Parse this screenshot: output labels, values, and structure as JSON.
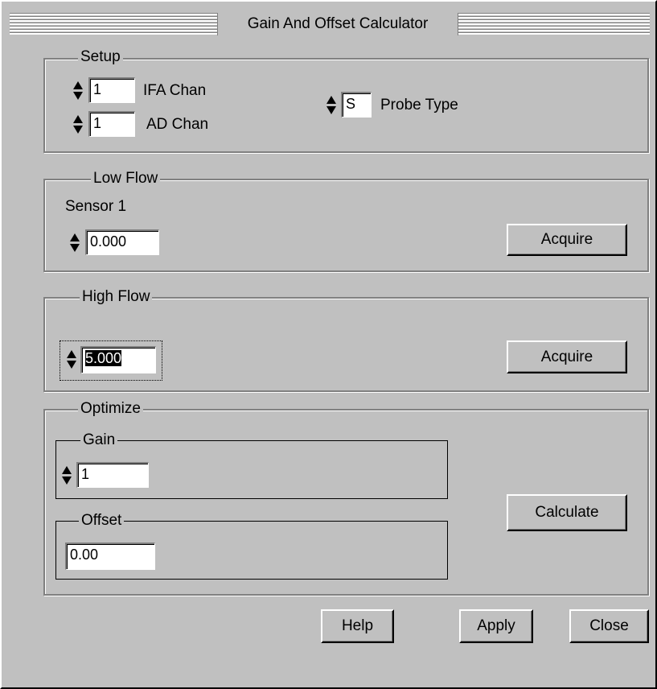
{
  "window": {
    "title": "Gain And Offset Calculator"
  },
  "setup": {
    "legend": "Setup",
    "ifa_chan": {
      "value": "1",
      "label": "IFA Chan"
    },
    "ad_chan": {
      "value": "1",
      "label": "AD Chan"
    },
    "probe_type": {
      "value": "S",
      "label": "Probe Type"
    }
  },
  "low_flow": {
    "legend": "Low Flow",
    "sensor_label": "Sensor 1",
    "value": "0.000",
    "acquire_label": "Acquire"
  },
  "high_flow": {
    "legend": "High Flow",
    "value": "5.000",
    "acquire_label": "Acquire"
  },
  "optimize": {
    "legend": "Optimize",
    "gain": {
      "legend": "Gain",
      "value": "1"
    },
    "offset": {
      "legend": "Offset",
      "value": "0.00"
    },
    "calculate_label": "Calculate"
  },
  "footer": {
    "help_label": "Help",
    "apply_label": "Apply",
    "close_label": "Close"
  }
}
